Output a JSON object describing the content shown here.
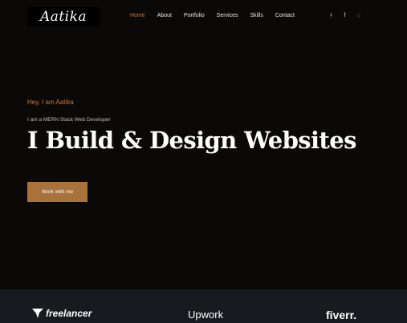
{
  "header": {
    "logo": "Aatika",
    "nav": [
      "Home",
      "About",
      "Portfolio",
      "Services",
      "Skills",
      "Contact"
    ],
    "social_icons": [
      "github-icon",
      "facebook-icon",
      "chat-icon"
    ]
  },
  "hero": {
    "greeting": "Hey, I am Aatika",
    "subtitle": "I am a MERN Stack Web Developer",
    "title": "I Build & Design Websites",
    "cta_label": "Work with me"
  },
  "platforms": [
    {
      "name": "freelancer"
    },
    {
      "name": "Upwork"
    },
    {
      "name": "fiverr."
    }
  ],
  "colors": {
    "accent": "#c0793f",
    "cta": "#a8723a",
    "background": "#0b0908",
    "platform_bar": "#181a1f"
  }
}
